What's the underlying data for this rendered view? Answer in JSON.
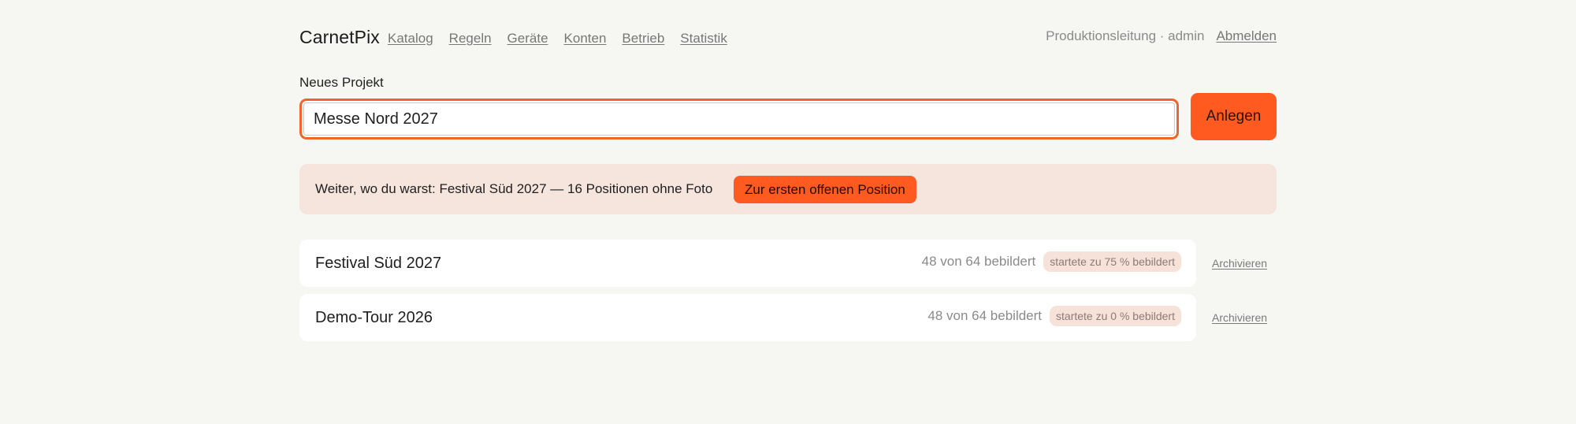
{
  "app": {
    "name": "CarnetPix"
  },
  "nav": {
    "items": [
      {
        "label": "Katalog"
      },
      {
        "label": "Regeln"
      },
      {
        "label": "Geräte"
      },
      {
        "label": "Konten"
      },
      {
        "label": "Betrieb"
      },
      {
        "label": "Statistik"
      }
    ]
  },
  "user": {
    "info": "Produktionsleitung · admin",
    "logout_label": "Abmelden"
  },
  "new_project": {
    "label": "Neues Projekt",
    "input_value": "Messe Nord 2027",
    "button_label": "Anlegen"
  },
  "resume": {
    "text": "Weiter, wo du warst: Festival Süd 2027 — 16 Positionen ohne Foto",
    "button_label": "Zur ersten offenen Position"
  },
  "projects": [
    {
      "name": "Festival Süd 2027",
      "count": "48 von 64 bebildert",
      "badge": "startete zu 75 % bebildert",
      "archive_label": "Archivieren"
    },
    {
      "name": "Demo-Tour 2026",
      "count": "48 von 64 bebildert",
      "badge": "startete zu 0 % bebildert",
      "archive_label": "Archivieren"
    }
  ],
  "colors": {
    "accent": "#ff5a1f",
    "banner_bg": "#f5e5dd",
    "page_bg": "#f6f6f3"
  }
}
